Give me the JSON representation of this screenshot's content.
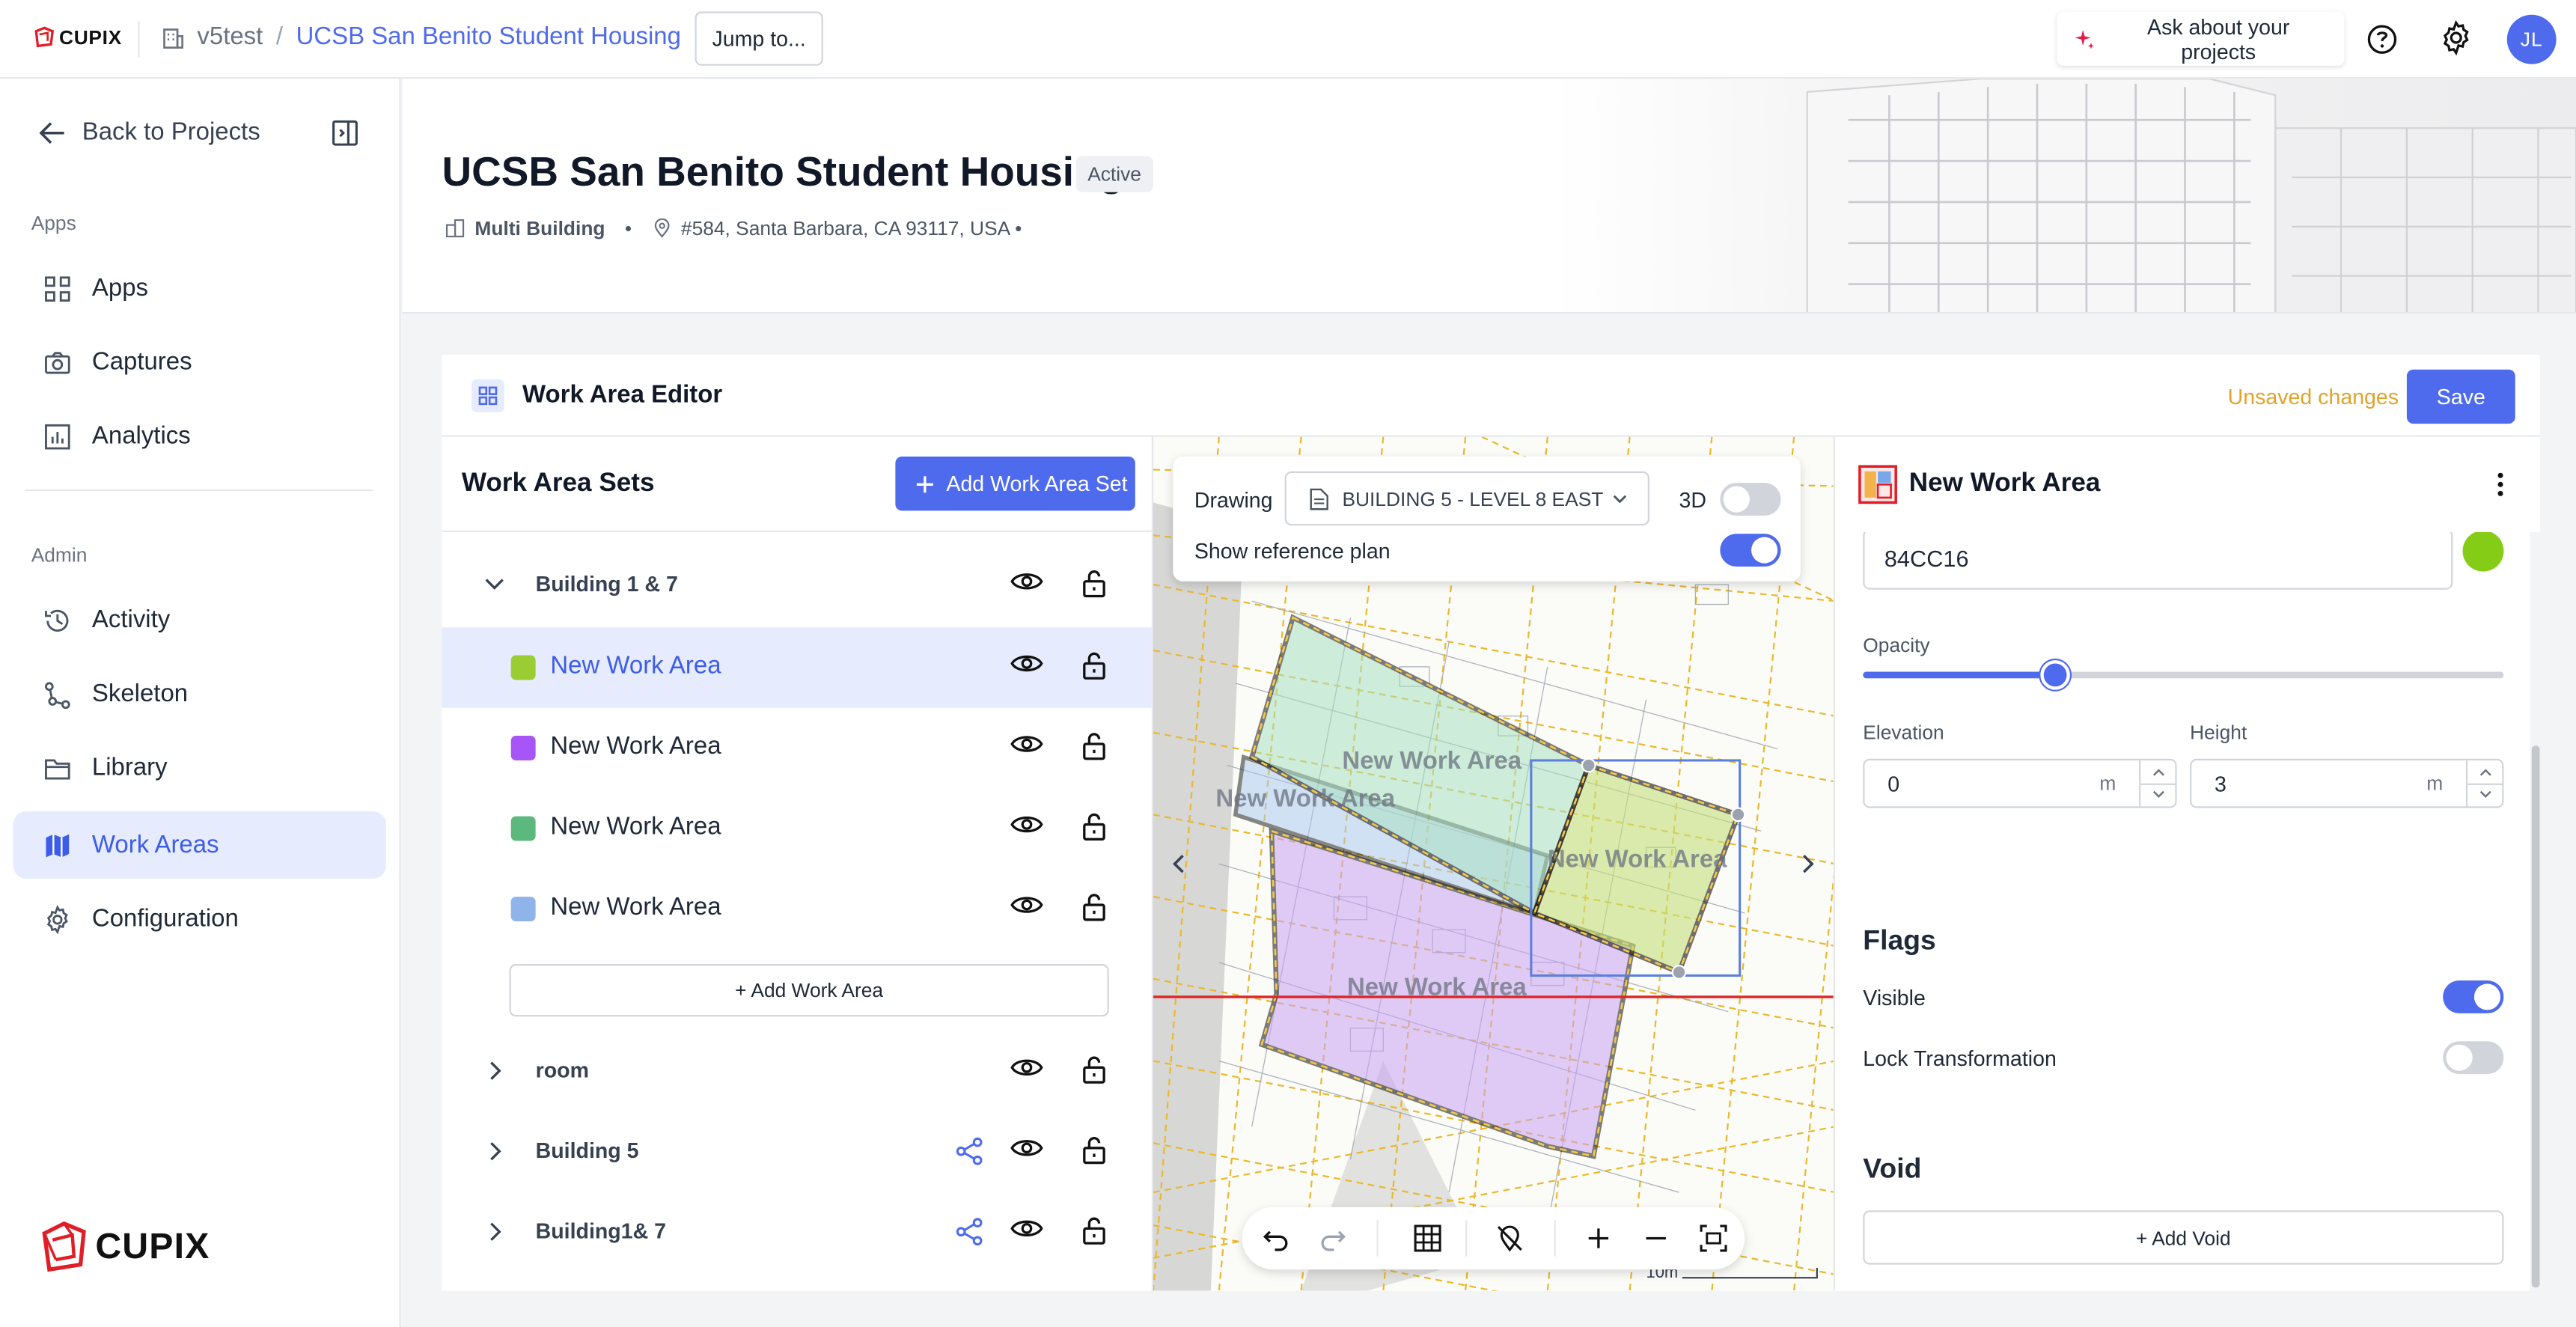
{
  "topbar": {
    "logo_text": "CUPIX",
    "workspace": "v5test",
    "separator": "/",
    "project": "UCSB San Benito Student Housing",
    "jump_label": "Jump to...",
    "ask_label": "Ask about your projects",
    "avatar_initials": "JL"
  },
  "sidebar": {
    "back_label": "Back to Projects",
    "apps_section": "Apps",
    "apps_items": [
      {
        "label": "Apps",
        "icon": "apps-grid-icon"
      },
      {
        "label": "Captures",
        "icon": "camera-icon"
      },
      {
        "label": "Analytics",
        "icon": "analytics-icon"
      }
    ],
    "admin_section": "Admin",
    "admin_items": [
      {
        "label": "Activity",
        "icon": "history-icon"
      },
      {
        "label": "Skeleton",
        "icon": "skeleton-nodes-icon"
      },
      {
        "label": "Library",
        "icon": "folder-icon"
      },
      {
        "label": "Work Areas",
        "icon": "map-icon",
        "active": true
      },
      {
        "label": "Configuration",
        "icon": "gear-icon"
      }
    ],
    "footer_logo": "CUPIX"
  },
  "header": {
    "title": "UCSB San Benito Student Housing",
    "status": "Active",
    "building_type": "Multi Building",
    "bullet": "•",
    "address": "#584, Santa Barbara, CA 93117, USA •"
  },
  "editor": {
    "title": "Work Area Editor",
    "unsaved": "Unsaved changes",
    "save_label": "Save"
  },
  "work_area_sets": {
    "title": "Work Area Sets",
    "add_set_label": "Add Work Area Set",
    "add_area_label": "+ Add Work Area",
    "groups": [
      {
        "name": "Building 1 & 7",
        "expanded": true,
        "shared": false
      },
      {
        "name": "room",
        "expanded": false,
        "shared": false
      },
      {
        "name": "Building 5",
        "expanded": false,
        "shared": true
      },
      {
        "name": "Building1& 7",
        "expanded": false,
        "shared": true
      }
    ],
    "areas": [
      {
        "name": "New Work Area",
        "color": "#9ACD32",
        "selected": true
      },
      {
        "name": "New Work Area",
        "color": "#A855F7",
        "selected": false
      },
      {
        "name": "New Work Area",
        "color": "#5DB87E",
        "selected": false
      },
      {
        "name": "New Work Area",
        "color": "#8FB4EA",
        "selected": false
      }
    ]
  },
  "drawing": {
    "label": "Drawing",
    "selected": "BUILDING 5 - LEVEL 8 EAST",
    "three_d_label": "3D",
    "three_d_on": false,
    "reference_label": "Show reference plan",
    "reference_on": true,
    "plan_label_text": "New Work Area",
    "scale_text": "10m"
  },
  "properties": {
    "title": "New Work Area",
    "color_hex": "84CC16",
    "color_value": "#84CC16",
    "opacity_label": "Opacity",
    "opacity_percent": 30,
    "elevation_label": "Elevation",
    "elevation_value": "0",
    "height_label": "Height",
    "height_value": "3",
    "unit": "m",
    "flags_title": "Flags",
    "visible_label": "Visible",
    "visible_on": true,
    "lock_label": "Lock Transformation",
    "lock_on": false,
    "void_title": "Void",
    "add_void_label": "+ Add Void"
  },
  "colors": {
    "accent": "#4F6BED",
    "accent_light": "#E6ECFD",
    "unsaved": "#E0A42A"
  }
}
